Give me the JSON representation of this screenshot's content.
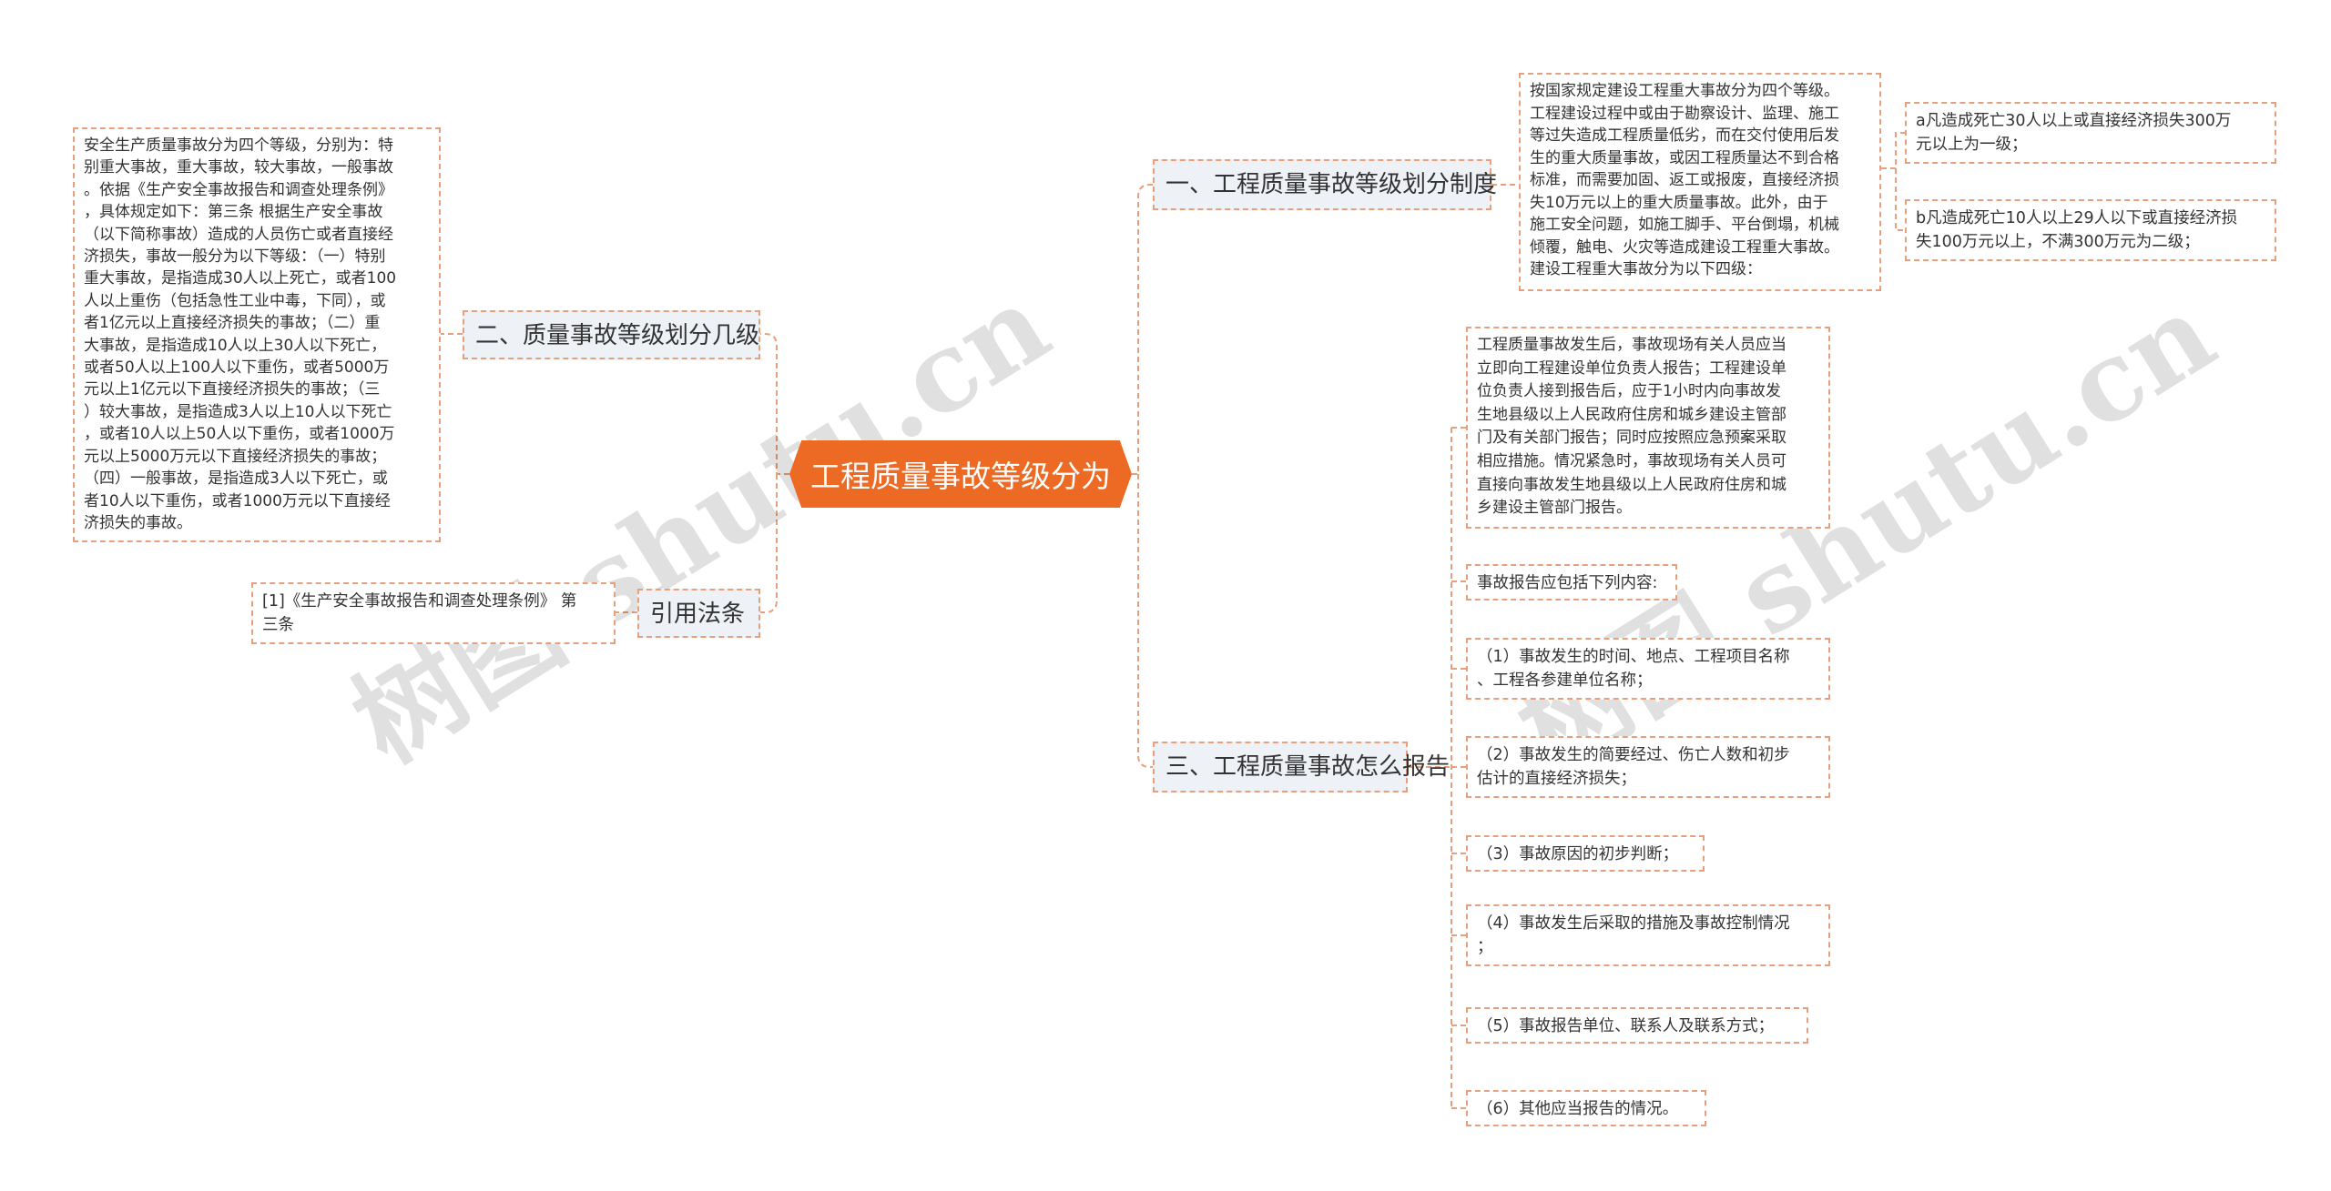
{
  "root": {
    "label": "工程质量事故等级分为"
  },
  "branches": {
    "b1": {
      "label": "一、工程质量事故等级划分制度"
    },
    "b2": {
      "label": "二、质量事故等级划分几级"
    },
    "b3": {
      "label": "三、工程质量事故怎么报告"
    },
    "b4": {
      "label": "引用法条"
    }
  },
  "leaves": {
    "b1_main": "按国家规定建设工程重大事故分为四个等级。\n工程建设过程中或由于勘察设计、监理、施工\n等过失造成工程质量低劣，而在交付使用后发\n生的重大质量事故，或因工程质量达不到合格\n标准，而需要加固、返工或报废，直接经济损\n失10万元以上的重大质量事故。此外，由于\n施工安全问题，如施工脚手、平台倒塌，机械\n倾覆，触电、火灾等造成建设工程重大事故。\n建设工程重大事故分为以下四级：",
    "b1_a": "a凡造成死亡30人以上或直接经济损失300万\n元以上为一级；",
    "b1_b": "b凡造成死亡10人以上29人以下或直接经济损\n失100万元以上，不满300万元为二级；",
    "b2_main": "安全生产质量事故分为四个等级，分别为：特\n别重大事故，重大事故，较大事故，一般事故\n。依据《生产安全事故报告和调查处理条例》\n，具体规定如下：第三条 根据生产安全事故\n（以下简称事故）造成的人员伤亡或者直接经\n济损失，事故一般分为以下等级：（一）特别\n重大事故，是指造成30人以上死亡，或者100\n人以上重伤（包括急性工业中毒，下同），或\n者1亿元以上直接经济损失的事故；（二）重\n大事故，是指造成10人以上30人以下死亡，\n或者50人以上100人以下重伤，或者5000万\n元以上1亿元以下直接经济损失的事故；（三\n）较大事故，是指造成3人以上10人以下死亡\n，或者10人以上50人以下重伤，或者1000万\n元以上5000万元以下直接经济损失的事故；\n（四）一般事故，是指造成3人以下死亡，或\n者10人以下重伤，或者1000万元以下直接经\n济损失的事故。",
    "b3_main": "工程质量事故发生后，事故现场有关人员应当\n立即向工程建设单位负责人报告；工程建设单\n位负责人接到报告后，应于1小时内向事故发\n生地县级以上人民政府住房和城乡建设主管部\n门及有关部门报告；同时应按照应急预案采取\n相应措施。情况紧急时，事故现场有关人员可\n直接向事故发生地县级以上人民政府住房和城\n乡建设主管部门报告。",
    "b3_intro": "事故报告应包括下列内容:",
    "b3_1": "（1）事故发生的时间、地点、工程项目名称\n、工程各参建单位名称；",
    "b3_2": "（2）事故发生的简要经过、伤亡人数和初步\n估计的直接经济损失；",
    "b3_3": "（3）事故原因的初步判断；",
    "b3_4": "（4）事故发生后采取的措施及事故控制情况\n；",
    "b3_5": "（5）事故报告单位、联系人及联系方式；",
    "b3_6": "（6）其他应当报告的情况。",
    "b4_ref": "[1]《生产安全事故报告和调查处理条例》 第\n三条"
  },
  "watermark": {
    "left": "树图 shutu.cn",
    "right": "树图 shutu.cn"
  },
  "colors": {
    "root_fill": "#ec6a24",
    "line": "#e8a07c",
    "branch_fill": "#eef2f7"
  }
}
